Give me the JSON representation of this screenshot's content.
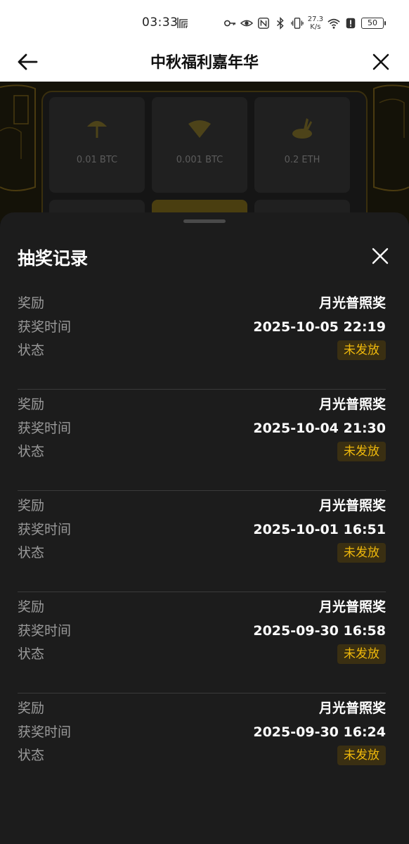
{
  "status_bar": {
    "time": "03:33",
    "speed_value": "27.3",
    "speed_unit": "K/s",
    "battery": "50",
    "icons": [
      "app-icon",
      "key-icon",
      "eye-icon",
      "nfc-icon",
      "bluetooth-icon",
      "vibrate-icon",
      "wifi-icon",
      "alert-icon",
      "battery-icon"
    ]
  },
  "header": {
    "title": "中秋福利嘉年华",
    "back_icon": "arrow-left-icon",
    "close_icon": "close-icon"
  },
  "background_prizes": [
    {
      "amount": "0.01 BTC",
      "icon": "umbrella-icon"
    },
    {
      "amount": "0.001 BTC",
      "icon": "fan-icon"
    },
    {
      "amount": "0.2 ETH",
      "icon": "rabbit-icon"
    }
  ],
  "sheet": {
    "title": "抽奖记录",
    "close_icon": "close-icon",
    "labels": {
      "reward": "奖励",
      "time": "获奖时间",
      "status": "状态"
    },
    "records": [
      {
        "reward": "月光普照奖",
        "time": "2025-10-05 22:19",
        "status": "未发放"
      },
      {
        "reward": "月光普照奖",
        "time": "2025-10-04 21:30",
        "status": "未发放"
      },
      {
        "reward": "月光普照奖",
        "time": "2025-10-01 16:51",
        "status": "未发放"
      },
      {
        "reward": "月光普照奖",
        "time": "2025-09-30 16:58",
        "status": "未发放"
      },
      {
        "reward": "月光普照奖",
        "time": "2025-09-30 16:24",
        "status": "未发放"
      }
    ]
  },
  "colors": {
    "accent": "#f0b90b",
    "sheet_bg": "#1c1c1c",
    "badge_bg": "#3a2f12"
  }
}
